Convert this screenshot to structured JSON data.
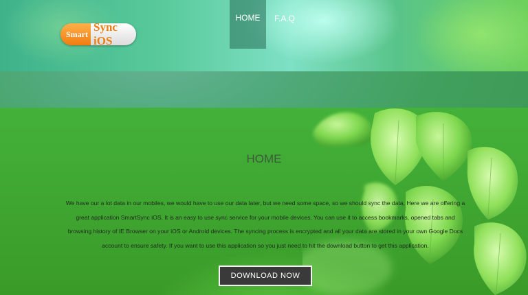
{
  "logo": {
    "left_text": "Smart",
    "right_text": "Sync iOS"
  },
  "nav": {
    "items": [
      {
        "label": "HOME",
        "active": true
      },
      {
        "label": "F.A.Q",
        "active": false
      }
    ]
  },
  "main": {
    "title": "HOME",
    "description": "We have our a lot data in our mobiles, we would have to use our data later, but we need some space, so we should sync the data, Here we are offering a great application SmartSync iOS. It is an easy to use sync service for your mobile devices. You can use it to access bookmarks, opened tabs and browsing history of IE Browser on your iOS or Android devices. The syncing process is encrypted and all your data are stored in your own Google Docs account to ensure safety. If you want to use this application so you just need to hit the download button to get this application.",
    "download_label": "DOWNLOAD NOW"
  },
  "colors": {
    "accent_orange": "#f07d10",
    "button_bg": "#3a3a3a",
    "nav_active": "#2d7a5a"
  }
}
